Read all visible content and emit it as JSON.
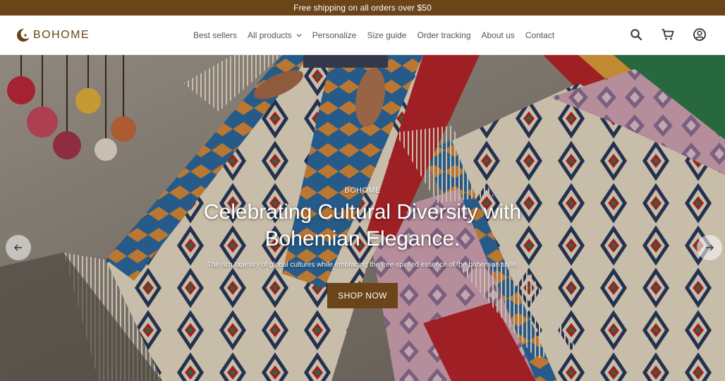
{
  "announcement": {
    "text": "Free shipping on all orders over $50"
  },
  "header": {
    "logo_text": "BOHOME",
    "nav": [
      {
        "label": "Best sellers"
      },
      {
        "label": "All products",
        "has_dropdown": true
      },
      {
        "label": "Personalize"
      },
      {
        "label": "Size guide"
      },
      {
        "label": "Order tracking"
      },
      {
        "label": "About us"
      },
      {
        "label": "Contact"
      }
    ],
    "icons": [
      "search-icon",
      "cart-icon",
      "account-icon"
    ]
  },
  "hero": {
    "eyebrow": "BOHOME",
    "title_line1": "Celebrating Cultural Diversity with",
    "title_line2": "Bohemian Elegance.",
    "subtitle": "The rich tapestry of global cultures while embracing the free-spirited essence of the bohemian style.",
    "cta_label": "SHOP NOW"
  },
  "colors": {
    "brand": "#6b4419",
    "announcement_bg": "#6b4419",
    "button_bg": "#6b4419"
  }
}
